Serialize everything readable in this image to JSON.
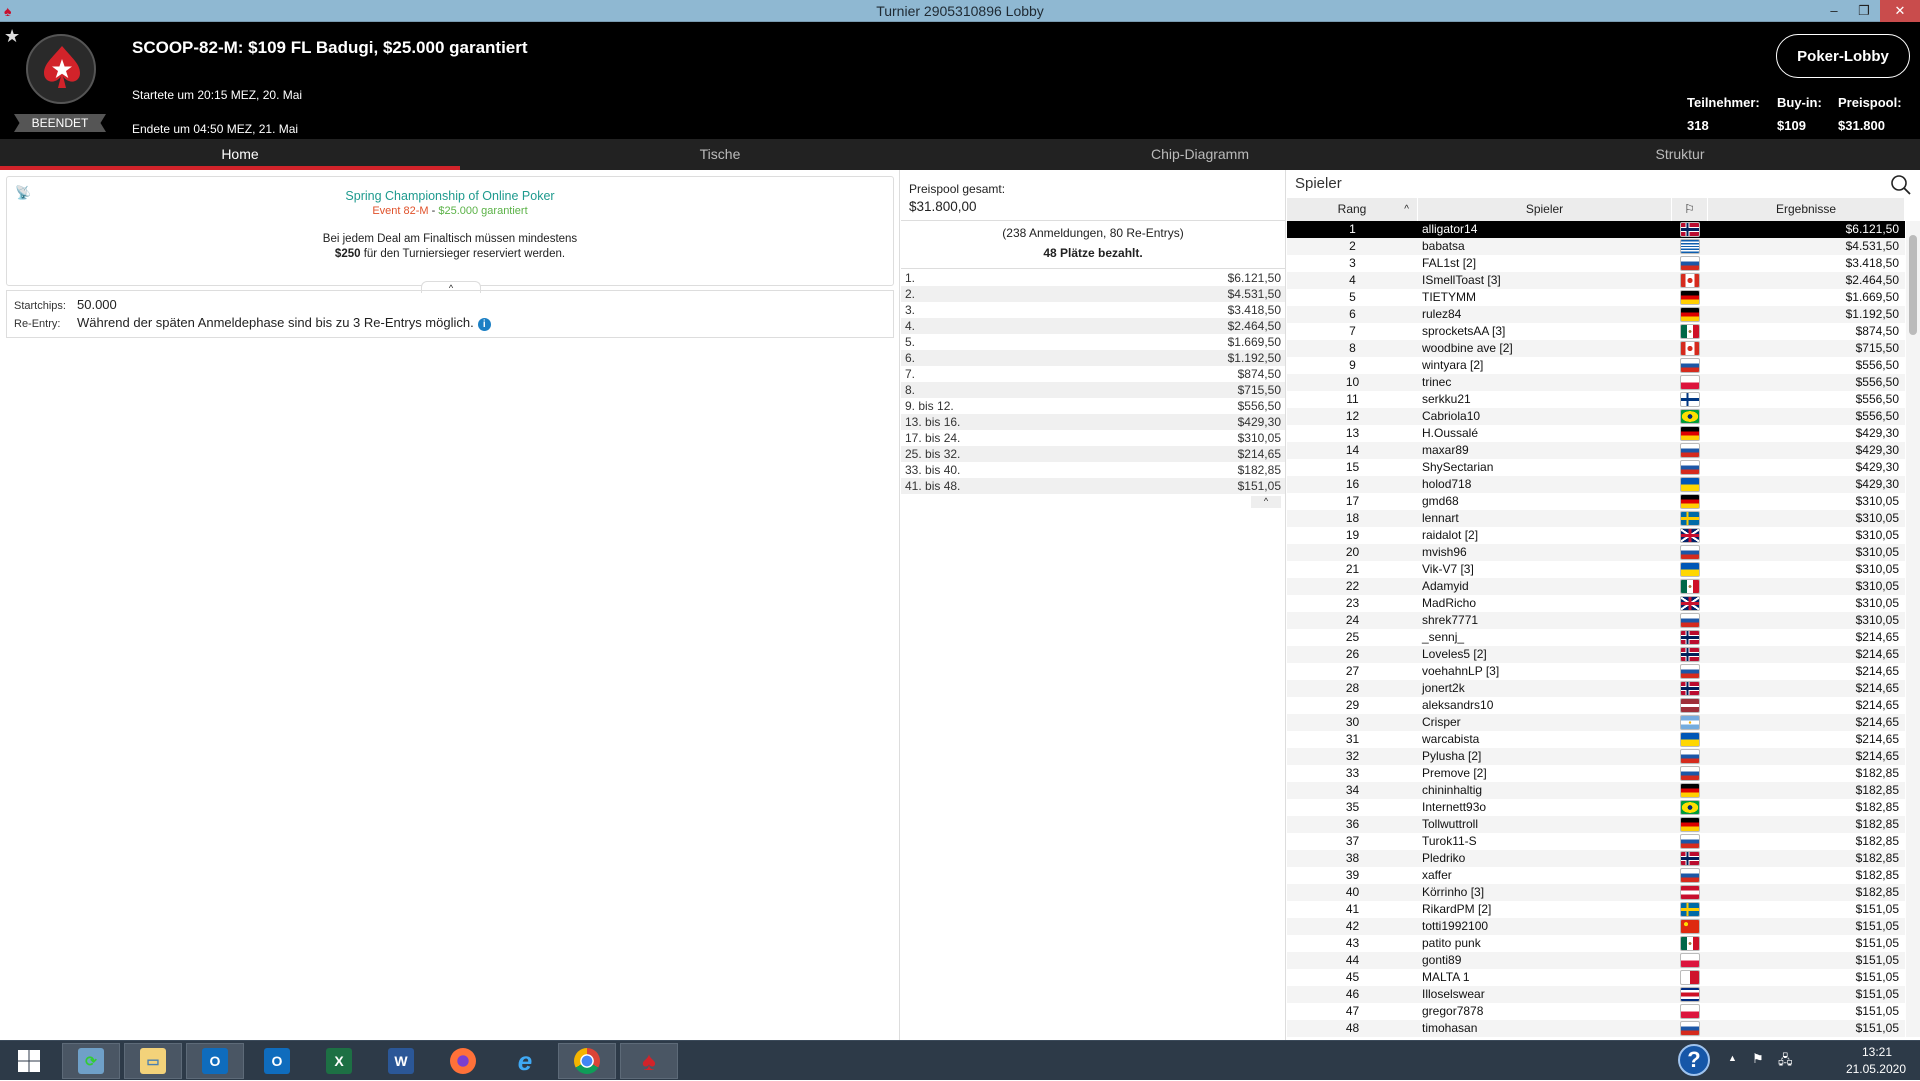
{
  "window": {
    "title": "Turnier 2905310896 Lobby",
    "minimize": "–",
    "maximize": "❐",
    "close": "✕"
  },
  "header": {
    "title": "SCOOP-82-M: $109 FL Badugi, $25.000 garantiert",
    "started": "Startete um 20:15 MEZ, 20. Mai",
    "ended": "Endete um 04:50 MEZ, 21. Mai",
    "status": "BEENDET",
    "lobby_button": "Poker-Lobby",
    "stats": [
      {
        "label": "Teilnehmer:",
        "value": "318"
      },
      {
        "label": "Buy-in:",
        "value": "$109"
      },
      {
        "label": "Preispool:",
        "value": "$31.800"
      }
    ]
  },
  "tabs": [
    {
      "label": "Home",
      "active": true
    },
    {
      "label": "Tische"
    },
    {
      "label": "Chip-Diagramm"
    },
    {
      "label": "Struktur"
    }
  ],
  "home": {
    "series": "Spring Championship of Online Poker",
    "event_name": "Event 82-M",
    "event_sep": " - ",
    "event_gtd": "$25.000 garantiert",
    "deal_line1": "Bei jedem Deal am Finaltisch müssen mindestens",
    "deal_amount": "$250",
    "deal_line2": " für den Turniersieger reserviert werden.",
    "collapse": "^",
    "startchips_label": "Startchips:",
    "startchips": "50.000",
    "reentry_label": "Re-Entry:",
    "reentry": "Während der späten Anmeldephase sind bis zu 3 Re-Entrys möglich.",
    "info": "i"
  },
  "prizepool": {
    "label": "Preispool gesamt:",
    "value": "$31.800,00",
    "entries": "(238 Anmeldungen, 80 Re-Entrys)",
    "paid": "48 Plätze bezahlt.",
    "collapse": "^",
    "payouts": [
      {
        "place": "1.",
        "amount": "$6.121,50"
      },
      {
        "place": "2.",
        "amount": "$4.531,50"
      },
      {
        "place": "3.",
        "amount": "$3.418,50"
      },
      {
        "place": "4.",
        "amount": "$2.464,50"
      },
      {
        "place": "5.",
        "amount": "$1.669,50"
      },
      {
        "place": "6.",
        "amount": "$1.192,50"
      },
      {
        "place": "7.",
        "amount": "$874,50"
      },
      {
        "place": "8.",
        "amount": "$715,50"
      },
      {
        "place": "9. bis 12.",
        "amount": "$556,50"
      },
      {
        "place": "13. bis 16.",
        "amount": "$429,30"
      },
      {
        "place": "17. bis 24.",
        "amount": "$310,05"
      },
      {
        "place": "25. bis 32.",
        "amount": "$214,65"
      },
      {
        "place": "33. bis 40.",
        "amount": "$182,85"
      },
      {
        "place": "41. bis 48.",
        "amount": "$151,05"
      }
    ]
  },
  "players_panel": {
    "search_label": "Spieler",
    "columns": {
      "rank": "Rang",
      "sort": "^",
      "player": "Spieler",
      "results": "Ergebnisse"
    },
    "selected_rank": "1"
  },
  "players": [
    [
      "1",
      "alligator14",
      "NO",
      "$6.121,50"
    ],
    [
      "2",
      "babatsa",
      "GR",
      "$4.531,50"
    ],
    [
      "3",
      "FAL1st [2]",
      "RU",
      "$3.418,50"
    ],
    [
      "4",
      "ISmellToast [3]",
      "CA",
      "$2.464,50"
    ],
    [
      "5",
      "TIETYMM",
      "DE",
      "$1.669,50"
    ],
    [
      "6",
      "rulez84",
      "DE",
      "$1.192,50"
    ],
    [
      "7",
      "sprocketsAA [3]",
      "MX",
      "$874,50"
    ],
    [
      "8",
      "woodbine ave [2]",
      "CA",
      "$715,50"
    ],
    [
      "9",
      "wintyara [2]",
      "RU",
      "$556,50"
    ],
    [
      "10",
      "trinec",
      "PL",
      "$556,50"
    ],
    [
      "11",
      "serkku21",
      "FI",
      "$556,50"
    ],
    [
      "12",
      "Cabriola10",
      "BR",
      "$556,50"
    ],
    [
      "13",
      "H.Oussalé",
      "DE",
      "$429,30"
    ],
    [
      "14",
      "maxar89",
      "RU",
      "$429,30"
    ],
    [
      "15",
      "ShySectarian",
      "RU",
      "$429,30"
    ],
    [
      "16",
      "holod718",
      "UA",
      "$429,30"
    ],
    [
      "17",
      "gmd68",
      "DE",
      "$310,05"
    ],
    [
      "18",
      "lennart",
      "SE",
      "$310,05"
    ],
    [
      "19",
      "raidalot [2]",
      "GB",
      "$310,05"
    ],
    [
      "20",
      "mvish96",
      "RU",
      "$310,05"
    ],
    [
      "21",
      "Vik-V7 [3]",
      "UA",
      "$310,05"
    ],
    [
      "22",
      "Adamyid",
      "MX",
      "$310,05"
    ],
    [
      "23",
      "MadRicho",
      "GB",
      "$310,05"
    ],
    [
      "24",
      "shrek7771",
      "RU",
      "$310,05"
    ],
    [
      "25",
      "_sennj_",
      "NO",
      "$214,65"
    ],
    [
      "26",
      "Loveles5 [2]",
      "NO",
      "$214,65"
    ],
    [
      "27",
      "voehahnLP [3]",
      "RU",
      "$214,65"
    ],
    [
      "28",
      "jonert2k",
      "NO",
      "$214,65"
    ],
    [
      "29",
      "aleksandrs10",
      "LV",
      "$214,65"
    ],
    [
      "30",
      "Crisper",
      "AR",
      "$214,65"
    ],
    [
      "31",
      "warcabista",
      "UA",
      "$214,65"
    ],
    [
      "32",
      "Pylusha [2]",
      "RU",
      "$214,65"
    ],
    [
      "33",
      "Premove [2]",
      "RU",
      "$182,85"
    ],
    [
      "34",
      "chininhaltig",
      "DE",
      "$182,85"
    ],
    [
      "35",
      "Internett93o",
      "BR",
      "$182,85"
    ],
    [
      "36",
      "Tollwuttroll",
      "DE",
      "$182,85"
    ],
    [
      "37",
      "Turok11-S",
      "RU",
      "$182,85"
    ],
    [
      "38",
      "Pledriko",
      "NO",
      "$182,85"
    ],
    [
      "39",
      "xaffer",
      "RU",
      "$182,85"
    ],
    [
      "40",
      "Körrinho [3]",
      "AT",
      "$182,85"
    ],
    [
      "41",
      "RikardPM [2]",
      "SE",
      "$151,05"
    ],
    [
      "42",
      "totti1992100",
      "CN",
      "$151,05"
    ],
    [
      "43",
      "patito punk",
      "MX",
      "$151,05"
    ],
    [
      "44",
      "gonti89",
      "PL",
      "$151,05"
    ],
    [
      "45",
      "MALTA 1",
      "MT",
      "$151,05"
    ],
    [
      "46",
      "Illoselswear",
      "CR",
      "$151,05"
    ],
    [
      "47",
      "gregor7878",
      "PL",
      "$151,05"
    ],
    [
      "48",
      "timohasan",
      "RU",
      "$151,05"
    ]
  ],
  "taskbar": {
    "apps": [
      {
        "name": "start",
        "icon": "windows-icon"
      },
      {
        "name": "sync",
        "icon": "sync-icon"
      },
      {
        "name": "explorer",
        "icon": "folder-icon"
      },
      {
        "name": "outlook",
        "icon": "outlook-icon",
        "letter": "O"
      },
      {
        "name": "outlook2",
        "icon": "outlook-icon",
        "letter": "O"
      },
      {
        "name": "excel",
        "icon": "excel-icon",
        "letter": "X"
      },
      {
        "name": "word",
        "icon": "word-icon",
        "letter": "W"
      },
      {
        "name": "firefox",
        "icon": "firefox-icon"
      },
      {
        "name": "ie",
        "icon": "ie-icon",
        "letter": "e"
      },
      {
        "name": "chrome",
        "icon": "chrome-icon"
      },
      {
        "name": "pokerstars",
        "icon": "pokerstars-icon"
      }
    ],
    "help": "?",
    "time": "13:21",
    "date": "21.05.2020"
  },
  "colors": {
    "accent": "#d2232a",
    "header_bg": "#000000",
    "tab_bg": "#222222",
    "series": "#1e9a8e",
    "event": "#e0522b",
    "guarantee": "#5bb247",
    "titlebar": "#8fb8d2"
  }
}
